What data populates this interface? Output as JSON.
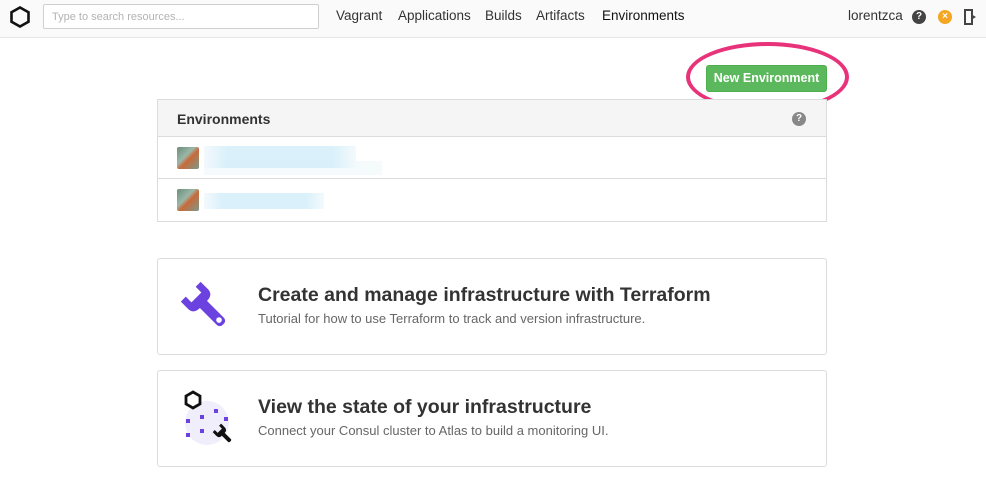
{
  "nav": {
    "search_placeholder": "Type to search resources...",
    "links": [
      {
        "label": "Vagrant"
      },
      {
        "label": "Applications"
      },
      {
        "label": "Builds"
      },
      {
        "label": "Artifacts"
      },
      {
        "label": "Environments"
      }
    ],
    "active_link": "Environments",
    "username": "lorentzca",
    "help_glyph": "?",
    "status_glyph": "×",
    "status_color": "#f5a623"
  },
  "actions": {
    "new_environment_label": "New Environment",
    "new_environment_color": "#5cb85c",
    "highlight_color": "#e8327a"
  },
  "environments": {
    "title": "Environments",
    "help_glyph": "?",
    "rows": [
      {
        "avatar": "user-avatar",
        "name_redacted": true
      },
      {
        "avatar": "user-avatar",
        "name_redacted": true
      }
    ]
  },
  "cards": [
    {
      "icon": "wrench-icon",
      "title": "Create and manage infrastructure with Terraform",
      "description": "Tutorial for how to use Terraform to track and version infrastructure."
    },
    {
      "icon": "consul-state-icon",
      "title": "View the state of your infrastructure",
      "description": "Connect your Consul cluster to Atlas to build a monitoring UI."
    }
  ],
  "icons": {
    "logo": "atlas-logo-icon",
    "help": "help-icon",
    "status": "status-icon",
    "logout": "logout-icon"
  }
}
